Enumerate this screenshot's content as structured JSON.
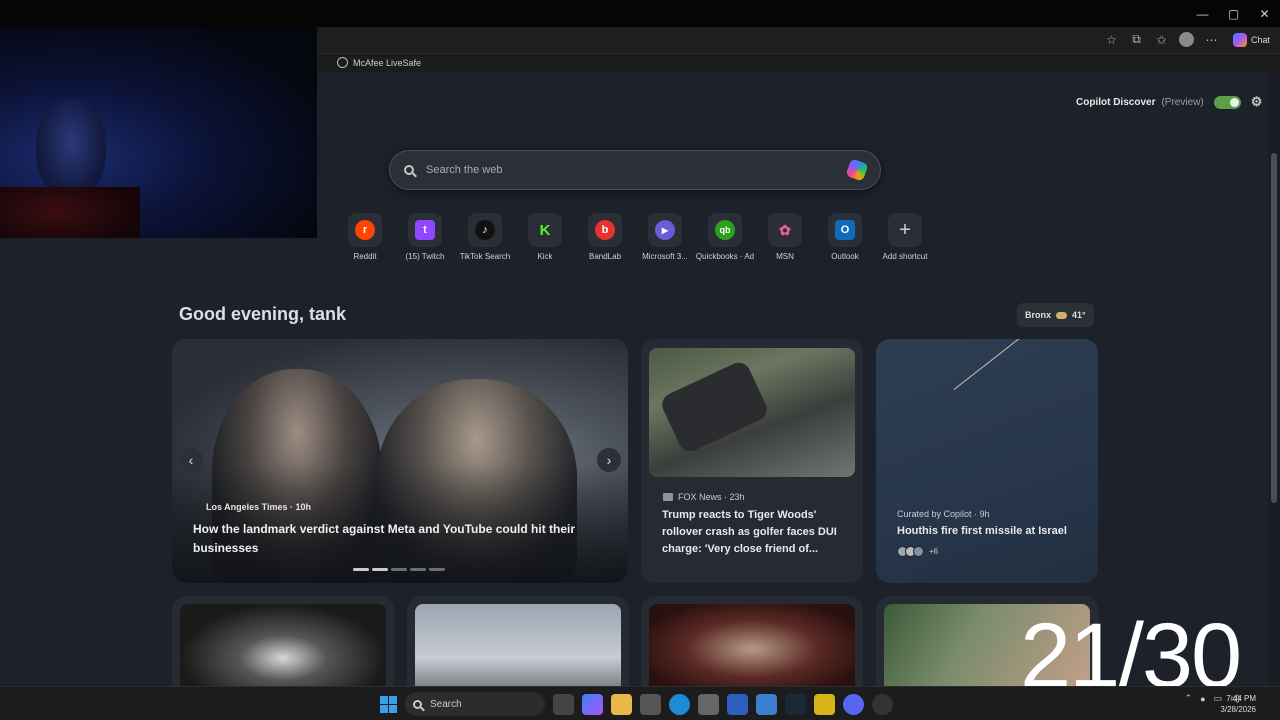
{
  "window": {
    "minimize": "—",
    "maximize": "▢",
    "close": "✕"
  },
  "toolbar": {
    "chat_label": "Chat"
  },
  "favorites": [
    {
      "label": "McAfee LiveSafe"
    }
  ],
  "discover": {
    "label": "Copilot Discover",
    "preview": "(Preview)",
    "enabled": true
  },
  "search": {
    "placeholder": "Search the web"
  },
  "shortcuts": [
    {
      "label": "Reddit",
      "glyph": "r",
      "color": "#ff4500"
    },
    {
      "label": "(15) Twitch",
      "glyph": "t",
      "color": "#9146ff"
    },
    {
      "label": "TikTok Search",
      "glyph": "♪",
      "color": "#111111"
    },
    {
      "label": "Kick",
      "glyph": "K",
      "color": "#2a2e36"
    },
    {
      "label": "BandLab",
      "glyph": "b",
      "color": "#e8322b"
    },
    {
      "label": "Microsoft 3...",
      "glyph": "▶",
      "color": "#6b5bd6"
    },
    {
      "label": "Quickbooks · Ad",
      "glyph": "qb",
      "color": "#2ca01c"
    },
    {
      "label": "MSN",
      "glyph": "✿",
      "color": "#3a3f8f"
    },
    {
      "label": "Outlook",
      "glyph": "O",
      "color": "#0f6cbd"
    },
    {
      "label": "Add shortcut",
      "glyph": "+",
      "color": "#2a2e36"
    }
  ],
  "greeting": "Good evening, tank",
  "weather": {
    "location": "Bronx",
    "temp": "41°"
  },
  "hero": {
    "source": "Los Angeles Times · 10h",
    "title": "How the landmark verdict against Meta and YouTube could hit their businesses",
    "slide_count": 5,
    "active_slide": 2
  },
  "cards": [
    {
      "source": "FOX News · 23h",
      "title": "Trump reacts to Tiger Woods' rollover crash as golfer faces DUI charge: 'Very close friend of..."
    },
    {
      "source": "Curated by Copilot · 9h",
      "title": "Houthis fire first missile at Israel",
      "extra": "+6"
    }
  ],
  "overlay_counter": "21/30",
  "taskbar": {
    "search_label": "Search",
    "time": "7:44 PM",
    "date": "3/28/2026"
  }
}
